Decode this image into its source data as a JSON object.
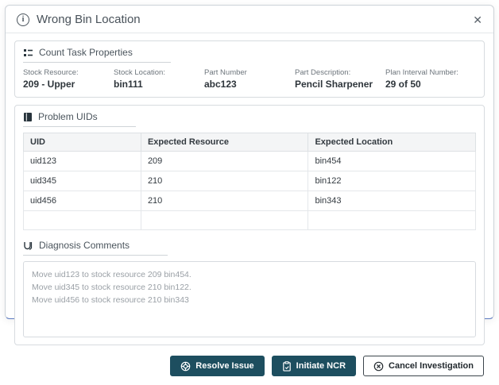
{
  "dialog": {
    "title": "Wrong Bin Location",
    "close_glyph": "✕",
    "info_glyph": "i"
  },
  "count_task": {
    "heading": "Count Task Properties",
    "fields": [
      {
        "label": "Stock Resource:",
        "value": "209 - Upper"
      },
      {
        "label": "Stock Location:",
        "value": "bin111"
      },
      {
        "label": "Part Number",
        "value": "abc123"
      },
      {
        "label": "Part Description:",
        "value": "Pencil Sharpener"
      },
      {
        "label": "Plan Interval Number:",
        "value": "29 of 50"
      }
    ]
  },
  "problem_uids": {
    "heading": "Problem UIDs",
    "columns": [
      "UID",
      "Expected Resource",
      "Expected Location"
    ],
    "rows": [
      [
        "uid123",
        "209",
        "bin454"
      ],
      [
        "uid345",
        "210",
        "bin122"
      ],
      [
        "uid456",
        "210",
        "bin343"
      ],
      [
        "",
        "",
        ""
      ]
    ]
  },
  "diagnosis": {
    "heading": "Diagnosis Comments",
    "lines": [
      "Move uid123 to stock resource 209 bin454.",
      "Move uid345 to stock resource 210 bin122.",
      "Move uid456 to stock resource 210 bin343"
    ]
  },
  "footer": {
    "resolve_label": "Resolve Issue",
    "ncr_label": "Initiate NCR",
    "cancel_label": "Cancel Investigation"
  },
  "colors": {
    "primary_button": "#1d4e5f",
    "section_icon": "#28343c"
  }
}
